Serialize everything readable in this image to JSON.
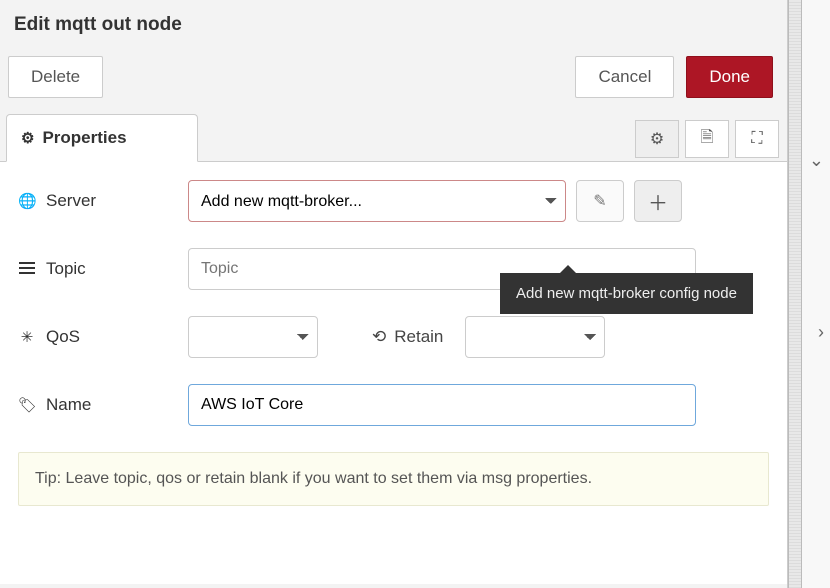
{
  "title": "Edit mqtt out node",
  "buttons": {
    "delete": "Delete",
    "cancel": "Cancel",
    "done": "Done"
  },
  "tabs": {
    "properties": "Properties"
  },
  "form": {
    "server": {
      "label": "Server",
      "selected": "Add new mqtt-broker..."
    },
    "topic": {
      "label": "Topic",
      "placeholder": "Topic",
      "value": ""
    },
    "qos": {
      "label": "QoS",
      "value": ""
    },
    "retain": {
      "label": "Retain",
      "value": ""
    },
    "name": {
      "label": "Name",
      "value": "AWS IoT Core"
    }
  },
  "tip": "Tip: Leave topic, qos or retain blank if you want to set them via msg properties.",
  "tooltip": "Add new mqtt-broker config node"
}
